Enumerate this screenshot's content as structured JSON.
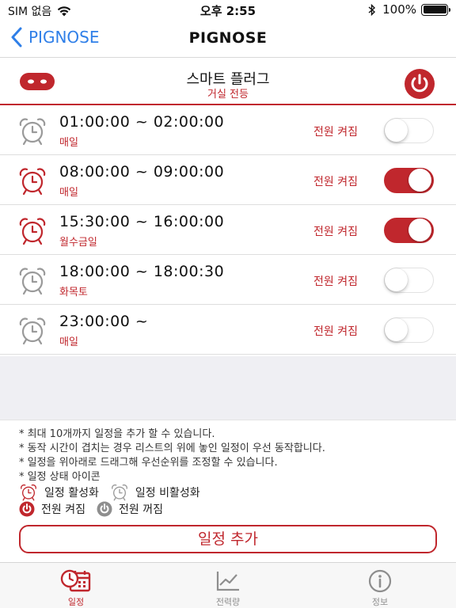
{
  "status_bar": {
    "carrier": "SIM 없음",
    "time": "오후 2:55",
    "battery": "100%"
  },
  "nav": {
    "back_label": "PIGNOSE",
    "title": "PIGNOSE"
  },
  "device": {
    "name": "스마트 플러그",
    "location": "거실 전등"
  },
  "schedules": [
    {
      "time": "01:00:00 ~ 02:00:00",
      "days": "매일",
      "power_label": "전원 켜짐",
      "active": false
    },
    {
      "time": "08:00:00 ~ 09:00:00",
      "days": "매일",
      "power_label": "전원 켜짐",
      "active": true
    },
    {
      "time": "15:30:00 ~ 16:00:00",
      "days": "월수금일",
      "power_label": "전원 켜짐",
      "active": true
    },
    {
      "time": "18:00:00 ~ 18:00:30",
      "days": "화목토",
      "power_label": "전원 켜짐",
      "active": false
    },
    {
      "time": "23:00:00 ~",
      "days": "매일",
      "power_label": "전원 켜짐",
      "active": false
    }
  ],
  "notes": {
    "lines": [
      "* 최대 10개까지 일정을 추가 할 수 있습니다.",
      "* 동작 시간이 겹치는 경우 리스트의 위에 놓인 일정이 우선 동작합니다.",
      "* 일정을 위아래로 드래그해 우선순위를 조정할 수 있습니다.",
      "* 일정 상태 아이콘"
    ],
    "legend_active": "일정 활성화",
    "legend_inactive": "일정 비활성화",
    "legend_power_on": "전원 켜짐",
    "legend_power_off": "전원 꺼짐"
  },
  "add_button": "일정 추가",
  "tabs": [
    {
      "label": "일정",
      "icon": "calendar-clock-icon",
      "active": true
    },
    {
      "label": "전력량",
      "icon": "chart-icon",
      "active": false
    },
    {
      "label": "정보",
      "icon": "info-icon",
      "active": false
    }
  ],
  "colors": {
    "accent": "#c0272d",
    "link": "#2f7fe8",
    "inactive_icon": "#9a9a9a"
  }
}
